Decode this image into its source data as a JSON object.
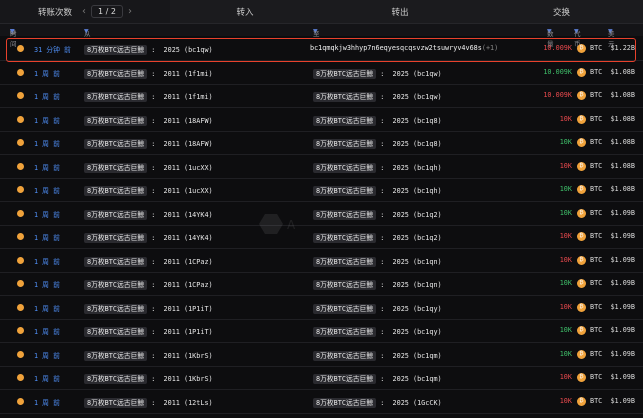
{
  "tabs": {
    "transfers_label": "转账次数",
    "page_indicator": "1 / 2",
    "inflow": "转入",
    "outflow": "转出",
    "swap": "交换"
  },
  "header": {
    "time": "时间",
    "from": "从",
    "to": "至",
    "amount": "数量",
    "token": "代币",
    "usd": "美元"
  },
  "rows": [
    {
      "time": "31 分钟 前",
      "from_tag": "8万枚BTC远古巨鲸",
      "from_addr": "2025 (bc1qw)",
      "to_addr": "bc1qmqkjw3hhyp7n6eqyesqcqsvzw2tsuwryv4v68s",
      "to_extra": "(+1)",
      "amount": "10.009K",
      "amount_color": "red",
      "token": "BTC",
      "usd": "$1.22B"
    },
    {
      "time": "1 周 前",
      "from_tag": "8万枚BTC远古巨鲸",
      "from_addr": "2011 (1f1mi)",
      "to_tag": "8万枚BTC远古巨鲸",
      "to_addr": "2025 (bc1qw)",
      "amount": "10.009K",
      "amount_color": "green",
      "token": "BTC",
      "usd": "$1.08B"
    },
    {
      "time": "1 周 前",
      "from_tag": "8万枚BTC远古巨鲸",
      "from_addr": "2011 (1f1mi)",
      "to_tag": "8万枚BTC远古巨鲸",
      "to_addr": "2025 (bc1qw)",
      "amount": "10.009K",
      "amount_color": "red",
      "token": "BTC",
      "usd": "$1.08B"
    },
    {
      "time": "1 周 前",
      "from_tag": "8万枚BTC远古巨鲸",
      "from_addr": "2011 (18AFW)",
      "to_tag": "8万枚BTC远古巨鲸",
      "to_addr": "2025 (bc1q8)",
      "amount": "10K",
      "amount_color": "red",
      "token": "BTC",
      "usd": "$1.08B"
    },
    {
      "time": "1 周 前",
      "from_tag": "8万枚BTC远古巨鲸",
      "from_addr": "2011 (18AFW)",
      "to_tag": "8万枚BTC远古巨鲸",
      "to_addr": "2025 (bc1q8)",
      "amount": "10K",
      "amount_color": "green",
      "token": "BTC",
      "usd": "$1.08B"
    },
    {
      "time": "1 周 前",
      "from_tag": "8万枚BTC远古巨鲸",
      "from_addr": "2011 (1ucXX)",
      "to_tag": "8万枚BTC远古巨鲸",
      "to_addr": "2025 (bc1qh)",
      "amount": "10K",
      "amount_color": "red",
      "token": "BTC",
      "usd": "$1.08B"
    },
    {
      "time": "1 周 前",
      "from_tag": "8万枚BTC远古巨鲸",
      "from_addr": "2011 (1ucXX)",
      "to_tag": "8万枚BTC远古巨鲸",
      "to_addr": "2025 (bc1qh)",
      "amount": "10K",
      "amount_color": "green",
      "token": "BTC",
      "usd": "$1.08B"
    },
    {
      "time": "1 周 前",
      "from_tag": "8万枚BTC远古巨鲸",
      "from_addr": "2011 (14YK4)",
      "to_tag": "8万枚BTC远古巨鲸",
      "to_addr": "2025 (bc1q2)",
      "amount": "10K",
      "amount_color": "green",
      "token": "BTC",
      "usd": "$1.09B"
    },
    {
      "time": "1 周 前",
      "from_tag": "8万枚BTC远古巨鲸",
      "from_addr": "2011 (14YK4)",
      "to_tag": "8万枚BTC远古巨鲸",
      "to_addr": "2025 (bc1q2)",
      "amount": "10K",
      "amount_color": "red",
      "token": "BTC",
      "usd": "$1.09B"
    },
    {
      "time": "1 周 前",
      "from_tag": "8万枚BTC远古巨鲸",
      "from_addr": "2011 (1CPaz)",
      "to_tag": "8万枚BTC远古巨鲸",
      "to_addr": "2025 (bc1qn)",
      "amount": "10K",
      "amount_color": "red",
      "token": "BTC",
      "usd": "$1.09B"
    },
    {
      "time": "1 周 前",
      "from_tag": "8万枚BTC远古巨鲸",
      "from_addr": "2011 (1CPaz)",
      "to_tag": "8万枚BTC远古巨鲸",
      "to_addr": "2025 (bc1qn)",
      "amount": "10K",
      "amount_color": "green",
      "token": "BTC",
      "usd": "$1.09B"
    },
    {
      "time": "1 周 前",
      "from_tag": "8万枚BTC远古巨鲸",
      "from_addr": "2011 (1P1iT)",
      "to_tag": "8万枚BTC远古巨鲸",
      "to_addr": "2025 (bc1qy)",
      "amount": "10K",
      "amount_color": "red",
      "token": "BTC",
      "usd": "$1.09B"
    },
    {
      "time": "1 周 前",
      "from_tag": "8万枚BTC远古巨鲸",
      "from_addr": "2011 (1P1iT)",
      "to_tag": "8万枚BTC远古巨鲸",
      "to_addr": "2025 (bc1qy)",
      "amount": "10K",
      "amount_color": "green",
      "token": "BTC",
      "usd": "$1.09B"
    },
    {
      "time": "1 周 前",
      "from_tag": "8万枚BTC远古巨鲸",
      "from_addr": "2011 (1KbrS)",
      "to_tag": "8万枚BTC远古巨鲸",
      "to_addr": "2025 (bc1qm)",
      "amount": "10K",
      "amount_color": "green",
      "token": "BTC",
      "usd": "$1.09B"
    },
    {
      "time": "1 周 前",
      "from_tag": "8万枚BTC远古巨鲸",
      "from_addr": "2011 (1KbrS)",
      "to_tag": "8万枚BTC远古巨鲸",
      "to_addr": "2025 (bc1qm)",
      "amount": "10K",
      "amount_color": "red",
      "token": "BTC",
      "usd": "$1.09B"
    },
    {
      "time": "1 周 前",
      "from_tag": "8万枚BTC远古巨鲸",
      "from_addr": "2011 (12tLs)",
      "to_tag": "8万枚BTC远古巨鲸",
      "to_addr": "2025 (1GcCK)",
      "amount": "10K",
      "amount_color": "red",
      "token": "BTC",
      "usd": "$1.09B"
    }
  ]
}
